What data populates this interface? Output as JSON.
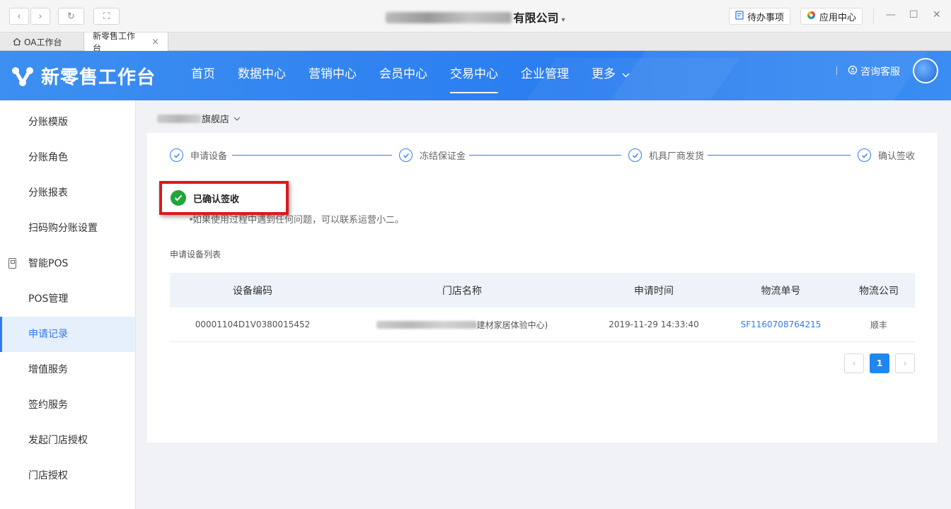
{
  "window": {
    "company_suffix": "有限公司",
    "caret": "▾",
    "todo_label": "待办事项",
    "apps_label": "应用中心",
    "min": "—",
    "max": "☐",
    "close": "✕"
  },
  "tabs": [
    {
      "label": "OA工作台"
    },
    {
      "label": "新零售工作台",
      "close": "×"
    }
  ],
  "header": {
    "logo_text": "新零售工作台",
    "nav": [
      {
        "label": "首页"
      },
      {
        "label": "数据中心"
      },
      {
        "label": "营销中心"
      },
      {
        "label": "会员中心"
      },
      {
        "label": "交易中心",
        "active": true
      },
      {
        "label": "企业管理"
      },
      {
        "label": "更多"
      }
    ],
    "service_label": "咨询客服"
  },
  "sidebar": {
    "items": [
      {
        "label": "分账模版"
      },
      {
        "label": "分账角色"
      },
      {
        "label": "分账报表"
      },
      {
        "label": "扫码购分账设置"
      },
      {
        "label": "智能POS"
      },
      {
        "label": "POS管理"
      },
      {
        "label": "申请记录"
      },
      {
        "label": "增值服务"
      },
      {
        "label": "签约服务"
      },
      {
        "label": "发起门店授权"
      },
      {
        "label": "门店授权"
      }
    ]
  },
  "main": {
    "store_suffix": "旗舰店",
    "steps": [
      {
        "label": "申请设备"
      },
      {
        "label": "冻结保证金"
      },
      {
        "label": "机具厂商发货"
      },
      {
        "label": "确认签收"
      }
    ],
    "status_text": "已确认签收",
    "tip_text": "如果使用过程中遇到任何问题，可以联系运营小二。",
    "list_title": "申请设备列表",
    "table": {
      "headers": [
        "设备编码",
        "门店名称",
        "申请时间",
        "物流单号",
        "物流公司"
      ],
      "rows": [
        {
          "device_code": "00001104D1V0380015452",
          "store_suffix": "建材家居体验中心)",
          "apply_time": "2019-11-29 14:33:40",
          "tracking_no": "SF1160708764215",
          "carrier": "顺丰"
        }
      ]
    },
    "pagination": {
      "prev": "‹",
      "current": "1",
      "next": "›"
    }
  },
  "colors": {
    "primary": "#2f7bf2",
    "success": "#20a53a",
    "highlight_border": "#e0161b"
  }
}
